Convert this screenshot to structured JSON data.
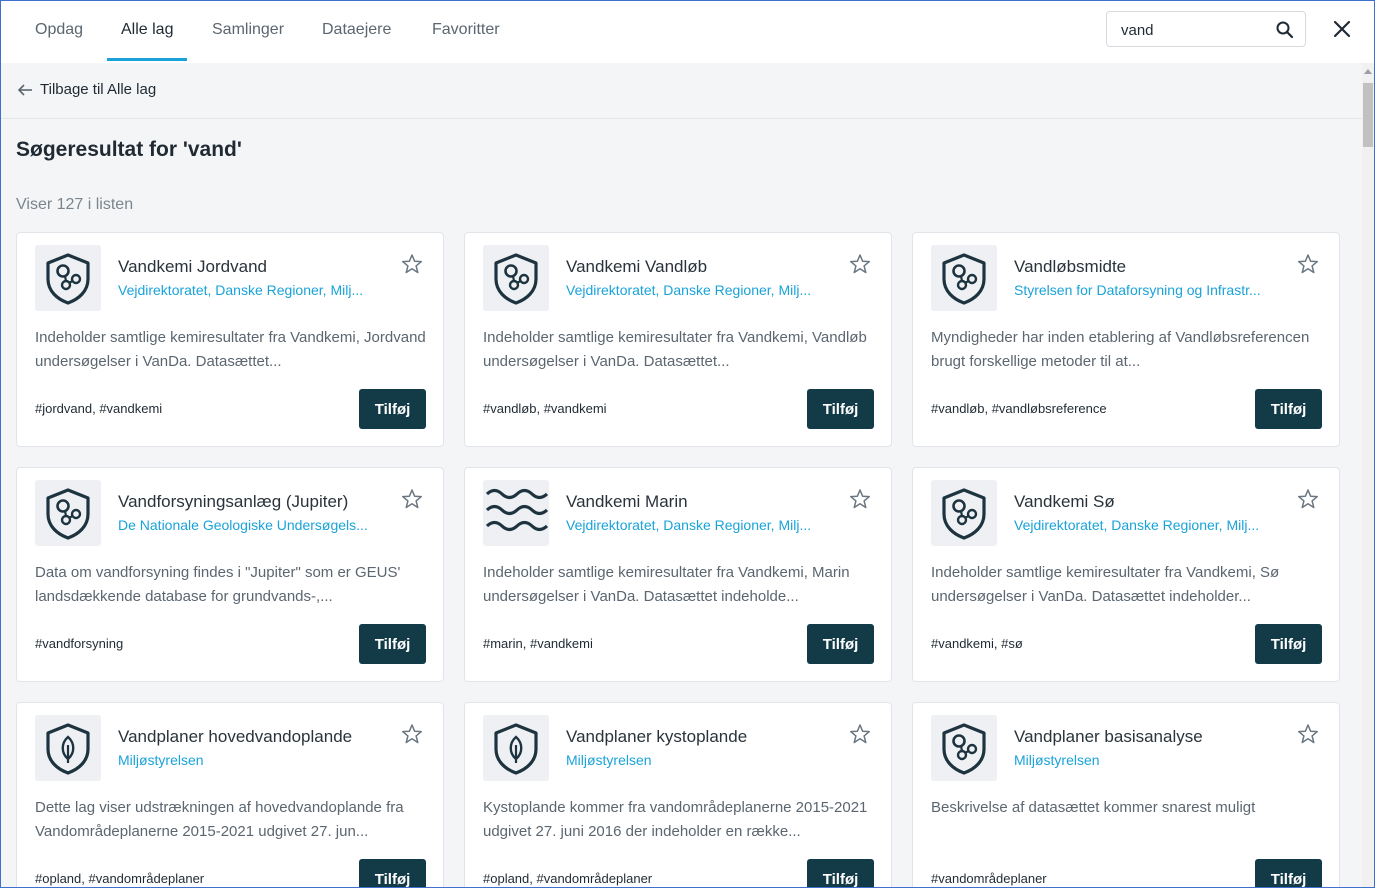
{
  "tabs": [
    {
      "label": "Opdag"
    },
    {
      "label": "Alle lag"
    },
    {
      "label": "Samlinger"
    },
    {
      "label": "Dataejere"
    },
    {
      "label": "Favoritter"
    }
  ],
  "active_tab": "Alle lag",
  "search": {
    "value": "vand",
    "icon": "search-icon"
  },
  "close_icon": "close-icon",
  "back": {
    "label": "Tilbage til Alle lag",
    "icon": "arrow-left-icon"
  },
  "heading": "Søgeresultat for 'vand'",
  "count_text": "Viser 127 i listen",
  "add_label": "Tilføj",
  "colors": {
    "accent": "#1aa3d9",
    "button": "#123a47",
    "icon": "#1d3440"
  },
  "cards": [
    {
      "title": "Vandkemi Jordvand",
      "owner": "Vejdirektoratet, Danske Regioner, Milj...",
      "description": "Indeholder samtlige kemiresultater fra Vandkemi, Jordvand undersøgelser i VanDa. Datasættet...",
      "tags": "#jordvand, #vandkemi",
      "icon": "shield-molecule-icon"
    },
    {
      "title": "Vandkemi Vandløb",
      "owner": "Vejdirektoratet, Danske Regioner, Milj...",
      "description": "Indeholder samtlige kemiresultater fra Vandkemi, Vandløb undersøgelser i VanDa. Datasættet...",
      "tags": "#vandløb, #vandkemi",
      "icon": "shield-molecule-icon"
    },
    {
      "title": "Vandløbsmidte",
      "owner": "Styrelsen for Dataforsyning og Infrastr...",
      "description": "Myndigheder har inden etablering af Vandløbsreferencen brugt forskellige metoder til at...",
      "tags": "#vandløb, #vandløbsreference",
      "icon": "shield-molecule-icon"
    },
    {
      "title": "Vandforsyningsanlæg (Jupiter)",
      "owner": "De Nationale Geologiske Undersøgels...",
      "description": "Data om vandforsyning findes i \"Jupiter\" som er GEUS' landsdækkende database for grundvands-,...",
      "tags": "#vandforsyning",
      "icon": "shield-molecule-icon"
    },
    {
      "title": "Vandkemi Marin",
      "owner": "Vejdirektoratet, Danske Regioner, Milj...",
      "description": "Indeholder samtlige kemiresultater fra Vandkemi, Marin undersøgelser i VanDa. Datasættet indeholde...",
      "tags": "#marin, #vandkemi",
      "icon": "waves-icon"
    },
    {
      "title": "Vandkemi Sø",
      "owner": "Vejdirektoratet, Danske Regioner, Milj...",
      "description": "Indeholder samtlige kemiresultater fra Vandkemi, Sø undersøgelser i VanDa. Datasættet indeholder...",
      "tags": "#vandkemi, #sø",
      "icon": "shield-molecule-icon"
    },
    {
      "title": "Vandplaner hovedvandoplande",
      "owner": "Miljøstyrelsen",
      "description": "Dette lag viser udstrækningen af hovedvandoplande fra Vandområdeplanerne 2015-2021 udgivet 27. jun...",
      "tags": "#opland, #vandområdeplaner",
      "icon": "shield-leaf-icon"
    },
    {
      "title": "Vandplaner kystoplande",
      "owner": "Miljøstyrelsen",
      "description": "Kystoplande kommer fra vandområdeplanerne 2015-2021 udgivet 27. juni 2016 der indeholder en række...",
      "tags": "#opland, #vandområdeplaner",
      "icon": "shield-leaf-icon"
    },
    {
      "title": "Vandplaner basisanalyse",
      "owner": "Miljøstyrelsen",
      "description": "Beskrivelse af datasættet kommer snarest muligt",
      "tags": "#vandområdeplaner",
      "icon": "shield-molecule-icon"
    }
  ]
}
